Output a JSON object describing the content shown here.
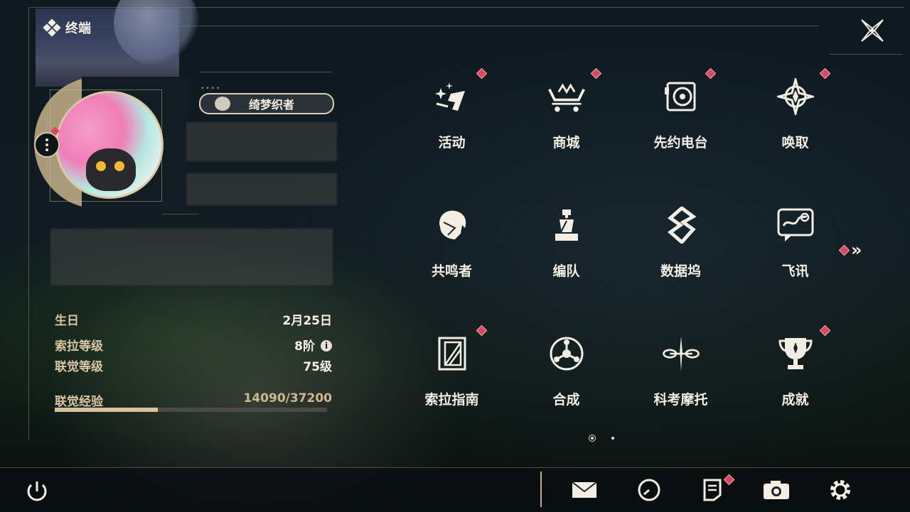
{
  "header": {
    "title": "终端",
    "title_icon": "diamond-cluster-icon",
    "close_icon": "close-icon"
  },
  "profile": {
    "nickname_badge": "绮梦织者",
    "info": {
      "birthday_label": "生日",
      "birthday_value": "2月25日",
      "sola_level_label": "索拉等级",
      "sola_level_value": "8阶",
      "link_level_label": "联觉等级",
      "link_level_value": "75级",
      "link_exp_label": "联觉经验",
      "link_exp_value": "14090/37200",
      "link_exp_progress": 0.379
    }
  },
  "menu": {
    "items": [
      {
        "label": "活动",
        "icon": "activity-sparkle-icon",
        "badge": true
      },
      {
        "label": "商城",
        "icon": "shop-cart-icon",
        "badge": true
      },
      {
        "label": "先约电台",
        "icon": "radio-icon",
        "badge": true
      },
      {
        "label": "唤取",
        "icon": "summon-compass-icon",
        "badge": true
      },
      {
        "label": "共鸣者",
        "icon": "resonator-head-icon",
        "badge": false
      },
      {
        "label": "编队",
        "icon": "chess-team-icon",
        "badge": false
      },
      {
        "label": "数据坞",
        "icon": "data-dock-icon",
        "badge": false
      },
      {
        "label": "飞讯",
        "icon": "chat-bubble-icon",
        "badge": false
      },
      {
        "label": "索拉指南",
        "icon": "guide-book-icon",
        "badge": true
      },
      {
        "label": "合成",
        "icon": "synthesis-icon",
        "badge": false
      },
      {
        "label": "科考摩托",
        "icon": "motorbike-icon",
        "badge": false
      },
      {
        "label": "成就",
        "icon": "trophy-icon",
        "badge": true
      }
    ],
    "page": 1,
    "page_count": 2
  },
  "bottom_bar": {
    "icons": [
      "power-icon",
      "mail-icon",
      "clock-icon",
      "notice-icon",
      "camera-icon",
      "settings-gear-icon"
    ]
  },
  "colors": {
    "accent_gold": "#d6c3a0",
    "badge_red": "#d84860",
    "text_light": "#f2eee4"
  }
}
